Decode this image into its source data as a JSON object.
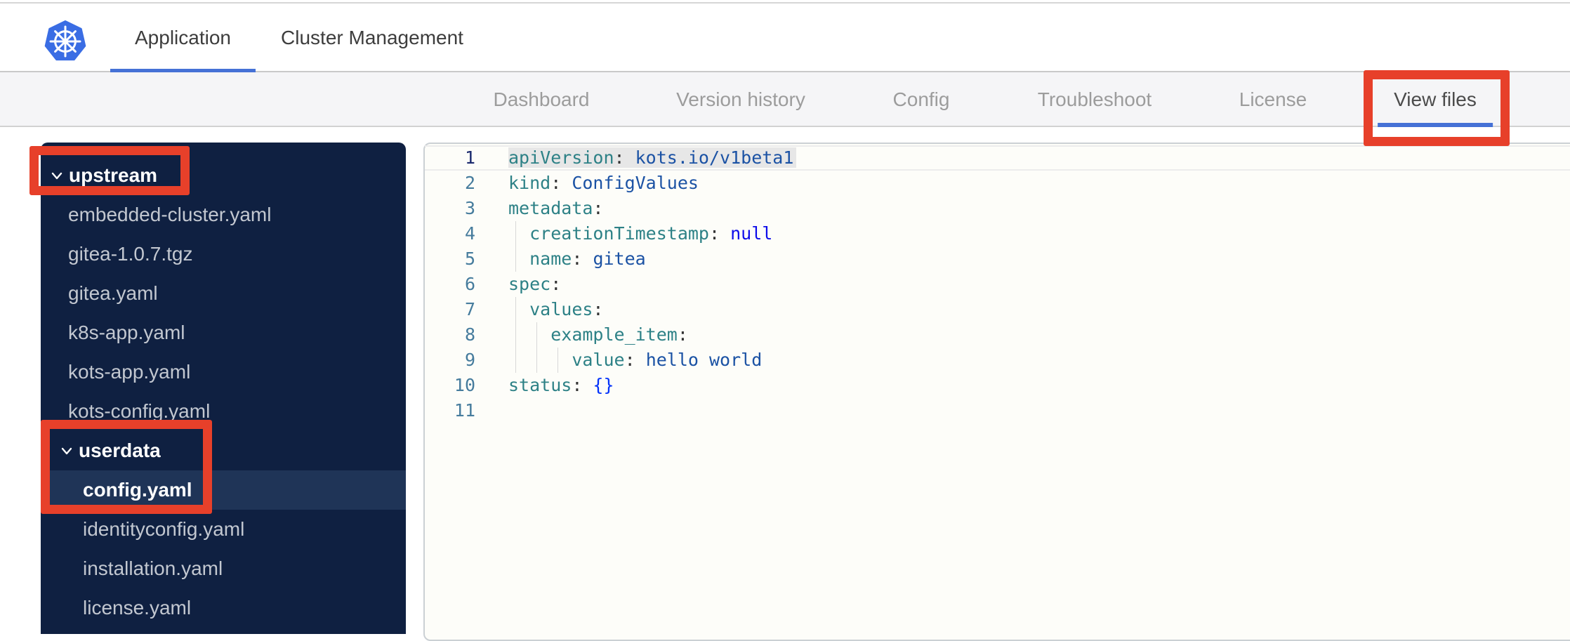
{
  "header": {
    "tabs": [
      {
        "label": "Application",
        "active": true
      },
      {
        "label": "Cluster Management",
        "active": false
      }
    ]
  },
  "subnav": {
    "tabs": [
      {
        "label": "Dashboard",
        "active": false
      },
      {
        "label": "Version history",
        "active": false
      },
      {
        "label": "Config",
        "active": false
      },
      {
        "label": "Troubleshoot",
        "active": false
      },
      {
        "label": "License",
        "active": false
      },
      {
        "label": "View files",
        "active": true
      }
    ]
  },
  "file_tree": {
    "items": [
      {
        "label": "upstream",
        "type": "folder",
        "indent": 0,
        "expanded": true
      },
      {
        "label": "embedded-cluster.yaml",
        "type": "file",
        "indent": 1
      },
      {
        "label": "gitea-1.0.7.tgz",
        "type": "file",
        "indent": 1
      },
      {
        "label": "gitea.yaml",
        "type": "file",
        "indent": 1
      },
      {
        "label": "k8s-app.yaml",
        "type": "file",
        "indent": 1
      },
      {
        "label": "kots-app.yaml",
        "type": "file",
        "indent": 1
      },
      {
        "label": "kots-config.yaml",
        "type": "file",
        "indent": 1
      },
      {
        "label": "userdata",
        "type": "folder",
        "indent": 1,
        "expanded": true
      },
      {
        "label": "config.yaml",
        "type": "file",
        "indent": 2,
        "selected": true
      },
      {
        "label": "identityconfig.yaml",
        "type": "file",
        "indent": 2
      },
      {
        "label": "installation.yaml",
        "type": "file",
        "indent": 2
      },
      {
        "label": "license.yaml",
        "type": "file",
        "indent": 2
      }
    ]
  },
  "editor": {
    "language": "yaml",
    "lines": [
      {
        "num": "1",
        "indent": 0,
        "active": true,
        "selected": true,
        "segments": [
          {
            "text": "apiVersion",
            "type": "key"
          },
          {
            "text": ": ",
            "type": "punct"
          },
          {
            "text": "kots.io/v1beta1",
            "type": "value"
          }
        ]
      },
      {
        "num": "2",
        "indent": 0,
        "segments": [
          {
            "text": "kind",
            "type": "key"
          },
          {
            "text": ": ",
            "type": "punct"
          },
          {
            "text": "ConfigValues",
            "type": "value"
          }
        ]
      },
      {
        "num": "3",
        "indent": 0,
        "segments": [
          {
            "text": "metadata",
            "type": "key"
          },
          {
            "text": ":",
            "type": "punct"
          }
        ]
      },
      {
        "num": "4",
        "indent": 2,
        "segments": [
          {
            "text": "  ",
            "type": "punct"
          },
          {
            "text": "creationTimestamp",
            "type": "key"
          },
          {
            "text": ": ",
            "type": "punct"
          },
          {
            "text": "null",
            "type": "keyword"
          }
        ]
      },
      {
        "num": "5",
        "indent": 2,
        "segments": [
          {
            "text": "  ",
            "type": "punct"
          },
          {
            "text": "name",
            "type": "key"
          },
          {
            "text": ": ",
            "type": "punct"
          },
          {
            "text": "gitea",
            "type": "value"
          }
        ]
      },
      {
        "num": "6",
        "indent": 0,
        "segments": [
          {
            "text": "spec",
            "type": "key"
          },
          {
            "text": ":",
            "type": "punct"
          }
        ]
      },
      {
        "num": "7",
        "indent": 2,
        "segments": [
          {
            "text": "  ",
            "type": "punct"
          },
          {
            "text": "values",
            "type": "key"
          },
          {
            "text": ":",
            "type": "punct"
          }
        ]
      },
      {
        "num": "8",
        "indent": 4,
        "segments": [
          {
            "text": "    ",
            "type": "punct"
          },
          {
            "text": "example_item",
            "type": "key"
          },
          {
            "text": ":",
            "type": "punct"
          }
        ]
      },
      {
        "num": "9",
        "indent": 6,
        "segments": [
          {
            "text": "      ",
            "type": "punct"
          },
          {
            "text": "value",
            "type": "key"
          },
          {
            "text": ": ",
            "type": "punct"
          },
          {
            "text": "hello world",
            "type": "value"
          }
        ]
      },
      {
        "num": "10",
        "indent": 0,
        "segments": [
          {
            "text": "status",
            "type": "key"
          },
          {
            "text": ": ",
            "type": "punct"
          },
          {
            "text": "{}",
            "type": "bracket"
          }
        ]
      },
      {
        "num": "11",
        "indent": 0,
        "segments": []
      }
    ]
  },
  "annotations": [
    {
      "target": "upstream"
    },
    {
      "target": "userdata-config.yaml"
    },
    {
      "target": "View files"
    }
  ],
  "colors": {
    "accent_blue": "#4571d6",
    "annotation_red": "#e7402a",
    "sidebar_bg": "#0f2041",
    "sidebar_highlight": "#1f3457",
    "logo_blue": "#3a6de4",
    "code_key": "#2d8186",
    "code_value": "#1b52a4",
    "code_keyword": "#0d0bea",
    "code_bracket": "#0433fa"
  }
}
